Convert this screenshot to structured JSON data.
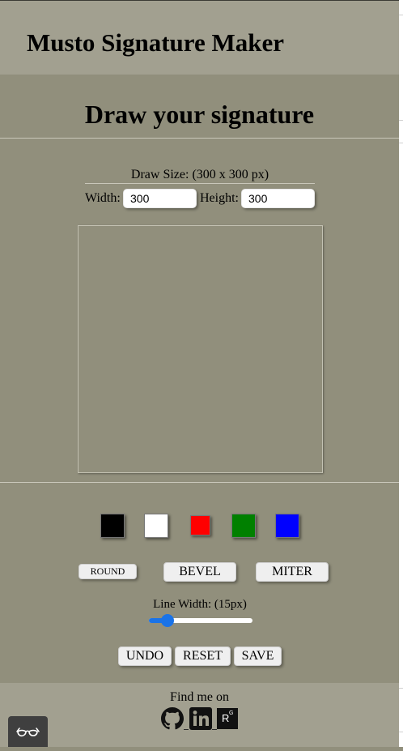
{
  "header": {
    "title": "Musto Signature Maker"
  },
  "main": {
    "section_title": "Draw your signature",
    "draw_size_label": "Draw Size: (300 x 300 px)",
    "width_label": "Width:",
    "width_value": "300",
    "height_label": "Height:",
    "height_value": "300"
  },
  "colors": [
    {
      "name": "black",
      "hex": "#000000"
    },
    {
      "name": "white",
      "hex": "#ffffff"
    },
    {
      "name": "red",
      "hex": "#ff0000"
    },
    {
      "name": "green",
      "hex": "#008000"
    },
    {
      "name": "blue",
      "hex": "#0000ff"
    }
  ],
  "line_join": {
    "round": "ROUND",
    "bevel": "BEVEL",
    "miter": "MITER"
  },
  "line_width": {
    "label": "Line Width: (15px)",
    "value_fraction": 0.18
  },
  "actions": {
    "undo": "UNDO",
    "reset": "RESET",
    "save": "SAVE"
  },
  "footer": {
    "find_label": "Find me on",
    "icons": [
      "github-icon",
      "linkedin-icon",
      "researchgate-icon"
    ],
    "researchgate_mark": "R",
    "researchgate_sup": "G"
  },
  "floating": {
    "icon": "glasses-icon"
  },
  "theme": {
    "accent": "#1a73e8",
    "background": "#918f7c",
    "header_bg": "#a2a090"
  }
}
